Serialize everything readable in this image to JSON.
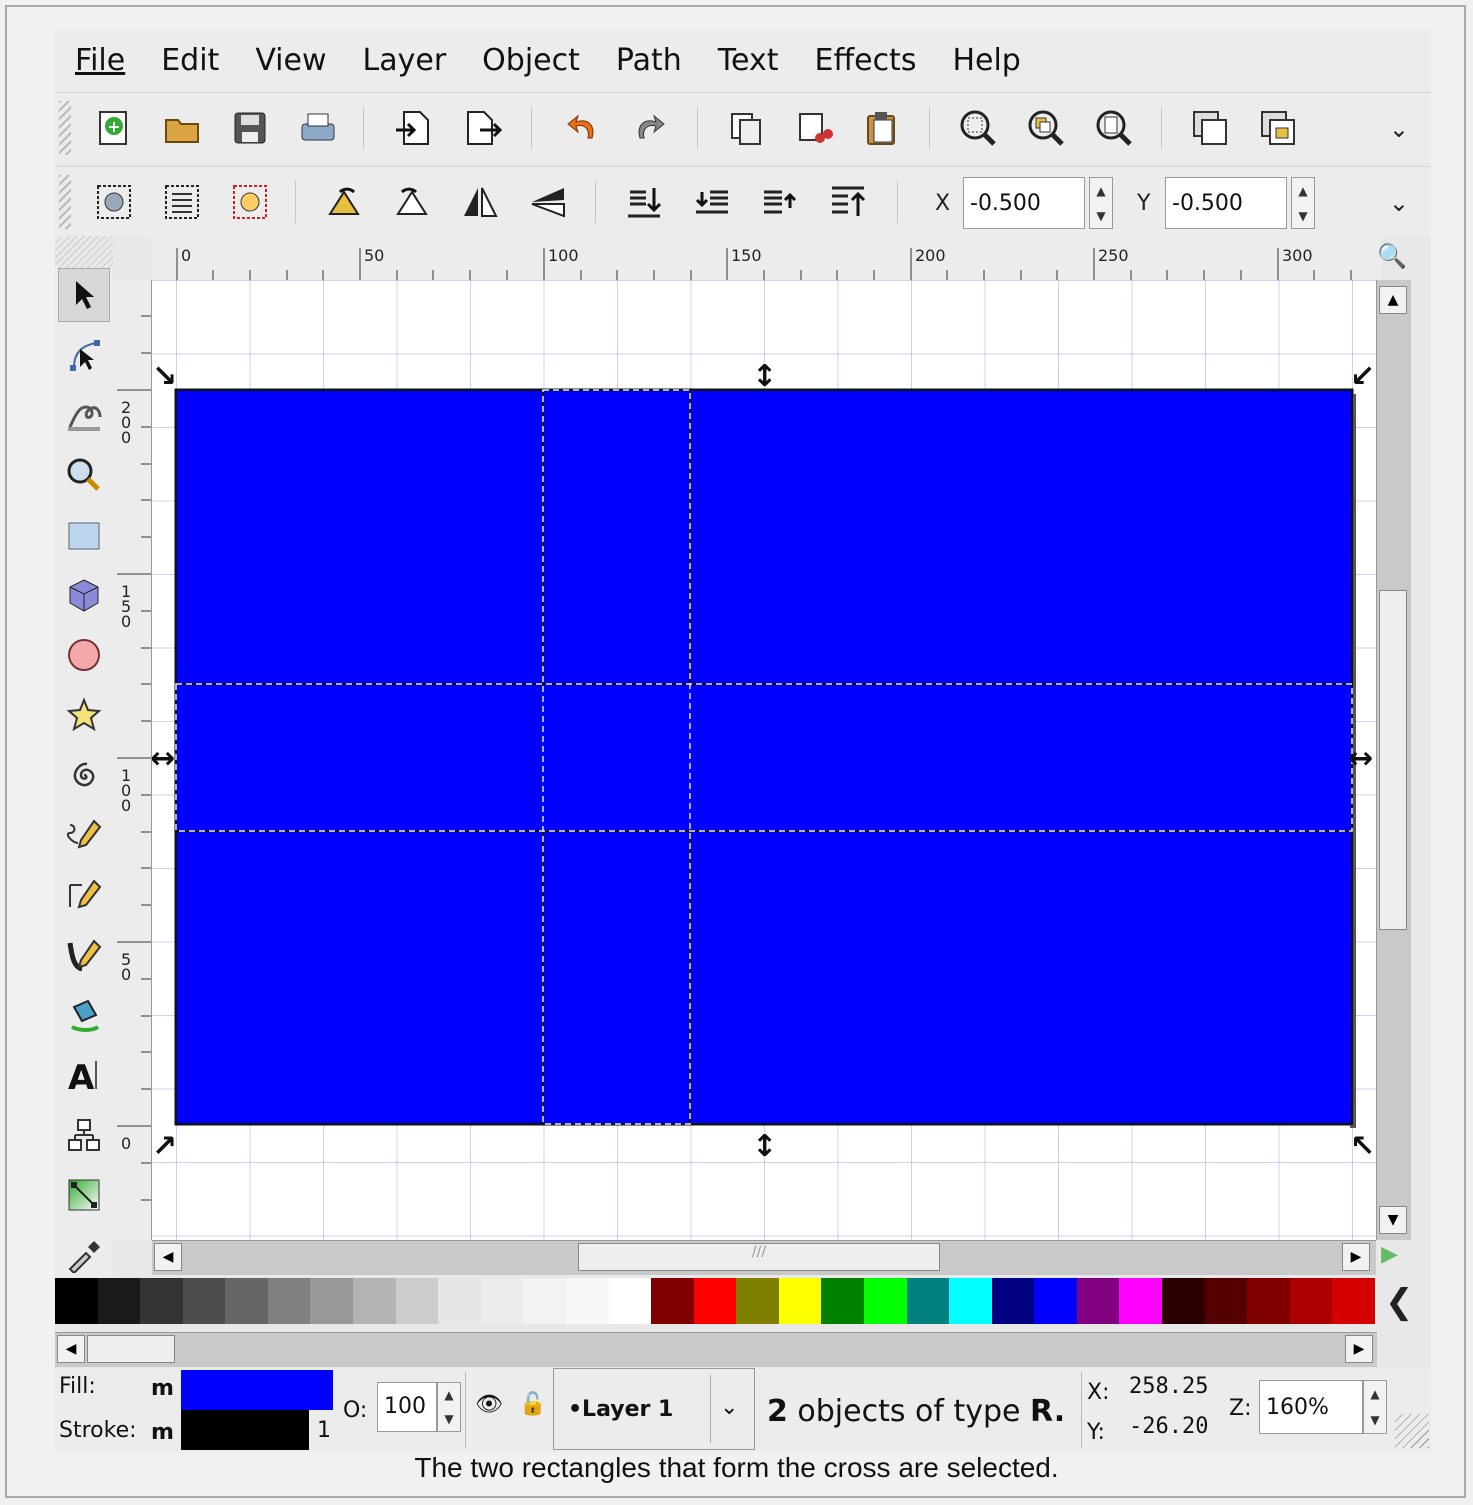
{
  "menu": [
    {
      "label": "File"
    },
    {
      "label": "Edit"
    },
    {
      "label": "View"
    },
    {
      "label": "Layer"
    },
    {
      "label": "Object"
    },
    {
      "label": "Path"
    },
    {
      "label": "Text"
    },
    {
      "label": "Effects"
    },
    {
      "label": "Help"
    }
  ],
  "toolbar_commands": {
    "icons": [
      "new-document-icon",
      "open-folder-icon",
      "save-icon",
      "print-icon",
      "import-icon",
      "export-icon",
      "undo-icon",
      "redo-icon",
      "duplicate-icon",
      "cut-icon",
      "paste-icon",
      "zoom-selection-icon",
      "zoom-drawing-icon",
      "zoom-page-icon",
      "group-icon",
      "ungroup-icon"
    ]
  },
  "toolbar_select": {
    "x_label": "X",
    "x_value": "-0.500",
    "y_label": "Y",
    "y_value": "-0.500",
    "icons": [
      "select-all-icon",
      "select-all-layers-icon",
      "deselect-icon",
      "rotate-ccw-icon",
      "rotate-cw-icon",
      "flip-horizontal-icon",
      "flip-vertical-icon",
      "lower-to-bottom-icon",
      "lower-icon",
      "raise-icon",
      "raise-to-top-icon"
    ]
  },
  "toolbox": [
    "selector-tool",
    "node-tool",
    "tweak-tool",
    "zoom-tool",
    "rectangle-tool",
    "3d-box-tool",
    "ellipse-tool",
    "star-tool",
    "spiral-tool",
    "pencil-tool",
    "pen-tool",
    "calligraphy-tool",
    "paint-bucket-tool",
    "text-tool",
    "connector-tool",
    "gradient-tool",
    "dropper-tool"
  ],
  "ruler": {
    "h_labels": [
      "0",
      "50",
      "100",
      "150",
      "200",
      "250",
      "300"
    ],
    "v_labels": [
      "200",
      "150",
      "100",
      "50",
      "0"
    ]
  },
  "palette": [
    "#000000",
    "#1a1a1a",
    "#333333",
    "#4d4d4d",
    "#666666",
    "#808080",
    "#999999",
    "#b3b3b3",
    "#cccccc",
    "#e6e6e6",
    "#ececec",
    "#f2f2f2",
    "#f8f8f8",
    "#ffffff",
    "#800000",
    "#ff0000",
    "#808000",
    "#ffff00",
    "#008000",
    "#00ff00",
    "#008080",
    "#00ffff",
    "#000080",
    "#0000ff",
    "#800080",
    "#ff00ff",
    "#2b0000",
    "#550000",
    "#800000",
    "#aa0000",
    "#d40000"
  ],
  "status": {
    "fill_label": "Fill:",
    "fill_value": "m",
    "fill_color": "#0000ff",
    "stroke_label": "Stroke:",
    "stroke_value": "m",
    "stroke_color": "#000000",
    "stroke_width": "1",
    "opacity_label": "O:",
    "opacity_value": "100",
    "layer_name": "•Layer 1",
    "message_count": "2",
    "message_text": " objects of type ",
    "message_type": "R.",
    "x_label": "X:",
    "x_value": "258.25",
    "y_label": "Y:",
    "y_value": "-26.20",
    "zoom_label": "Z:",
    "zoom_value": "160%"
  },
  "caption": "The two rectangles that form the cross are selected."
}
